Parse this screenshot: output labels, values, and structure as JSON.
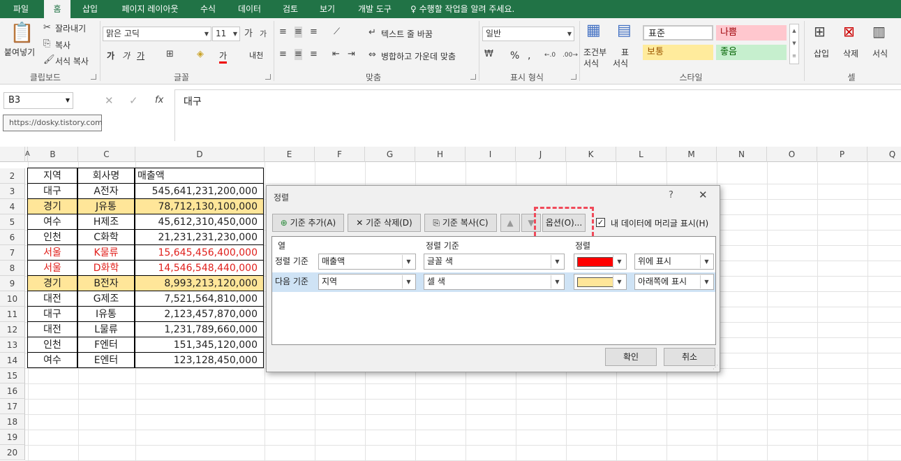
{
  "tabs": [
    "파일",
    "홈",
    "삽입",
    "페이지 레이아웃",
    "수식",
    "데이터",
    "검토",
    "보기",
    "개발 도구",
    "수행할 작업을 알려 주세요."
  ],
  "ribbon": {
    "clipboard": {
      "paste": "붙여넣기",
      "cut": "잘라내기",
      "copy": "복사",
      "format_painter": "서식 복사",
      "label": "클립보드"
    },
    "font": {
      "name": "맑은 고딕",
      "size": "11",
      "bold": "가",
      "italic": "가",
      "underline": "가",
      "color_a": "가",
      "label": "글꼴",
      "phonetic": "내천"
    },
    "align": {
      "wrap": "텍스트 줄 바꿈",
      "merge": "병합하고 가운데 맞춤",
      "label": "맞춤"
    },
    "number": {
      "format": "일반",
      "percent": "%",
      "comma": ",",
      "label": "표시 형식"
    },
    "styles": {
      "cond": "조건부",
      "cond2": "서식",
      "table": "표",
      "table2": "서식",
      "normal": "표준",
      "bad": "나쁨",
      "neutral": "보통",
      "good": "좋음",
      "label": "스타일"
    },
    "cells": {
      "insert": "삽입",
      "delete": "삭제",
      "format": "서식",
      "label": "셀"
    }
  },
  "formula_bar": {
    "name_box": "B3",
    "fx": "fx",
    "value": "대구",
    "tooltip": "https://dosky.tistory.com"
  },
  "columns": [
    "A",
    "B",
    "C",
    "D",
    "E",
    "F",
    "G",
    "H",
    "I",
    "J",
    "K",
    "L",
    "M",
    "N",
    "O",
    "P",
    "Q"
  ],
  "rows": [
    "2",
    "3",
    "4",
    "5",
    "6",
    "7",
    "8",
    "9",
    "10",
    "11",
    "12",
    "13",
    "14",
    "15",
    "16",
    "17",
    "18",
    "19",
    "20"
  ],
  "table": {
    "headers": [
      "지역",
      "회사명",
      "매출액"
    ],
    "data": [
      [
        "대구",
        "A전자",
        "545,641,231,200,000"
      ],
      [
        "경기",
        "J유통",
        "78,712,130,100,000"
      ],
      [
        "여수",
        "H제조",
        "45,612,310,450,000"
      ],
      [
        "인천",
        "C화학",
        "21,231,231,230,000"
      ],
      [
        "서울",
        "K물류",
        "15,645,456,400,000"
      ],
      [
        "서울",
        "D화학",
        "14,546,548,440,000"
      ],
      [
        "경기",
        "B전자",
        "8,993,213,120,000"
      ],
      [
        "대전",
        "G제조",
        "7,521,564,810,000"
      ],
      [
        "대구",
        "I유통",
        "2,123,457,870,000"
      ],
      [
        "대전",
        "L물류",
        "1,231,789,660,000"
      ],
      [
        "인천",
        "F엔터",
        "151,345,120,000"
      ],
      [
        "여수",
        "E엔터",
        "123,128,450,000"
      ]
    ]
  },
  "dialog": {
    "title": "정렬",
    "help": "?",
    "close": "✕",
    "add": "기준 추가(A)",
    "delete": "기준 삭제(D)",
    "copy": "기준 복사(C)",
    "options": "옵션(O)...",
    "header_checkbox": "내 데이터에 머리글 표시(H)",
    "col_heading": "열",
    "sort_on_heading": "정렬 기준",
    "order_heading": "정렬",
    "rows": [
      {
        "label": "정렬 기준",
        "column": "매출액",
        "sort_on": "글꼴 색",
        "color": "#ff0000",
        "position": "위에 표시"
      },
      {
        "label": "다음 기준",
        "column": "지역",
        "sort_on": "셀 색",
        "color": "#ffe699",
        "position": "아래쪽에 표시"
      }
    ],
    "ok": "확인",
    "cancel": "취소"
  },
  "colors": {
    "accent": "#217346",
    "highlight_row": "#ffe699",
    "red_text": "#e0201c",
    "callout": "#f04a5a"
  }
}
